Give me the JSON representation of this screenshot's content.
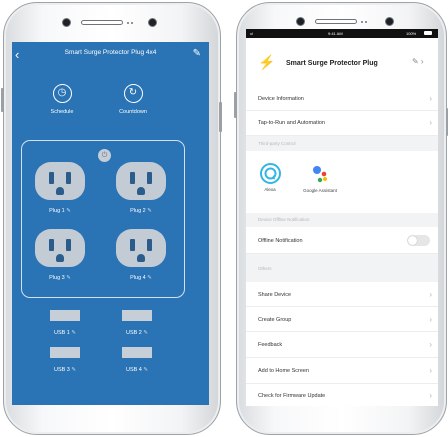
{
  "left": {
    "title": "Smart Surge Protector Plug 4x4",
    "back_icon": "chevron-left-icon",
    "edit_icon": "pencil-icon",
    "tools": [
      {
        "label": "Schedule",
        "icon": "clock-icon"
      },
      {
        "label": "Countdown",
        "icon": "timer-icon"
      }
    ],
    "power_icon": "power-icon",
    "plugs": [
      "Plug 1",
      "Plug 2",
      "Plug 3",
      "Plug 4"
    ],
    "usb": [
      "USB 1",
      "USB 2",
      "USB 3",
      "USB 4"
    ],
    "colors": {
      "background": "#2a73b4",
      "outlet": "#c3ccd5"
    }
  },
  "right": {
    "status": {
      "signal": "ııl",
      "time": "9:41 AM",
      "battery": "100%"
    },
    "device_name": "Smart Surge Protector Plug",
    "rows_top": [
      "Device Information",
      "Tap-to-Run and Automation"
    ],
    "third_party_header": "Third-party Control",
    "third_party": [
      {
        "name": "Alexa",
        "icon": "alexa-icon"
      },
      {
        "name": "Google Assistant",
        "icon": "google-assistant-icon"
      }
    ],
    "offline_header": "Device Offline Notification",
    "offline_row": "Offline Notification",
    "offline_enabled": false,
    "others_header": "Others",
    "rows_bottom": [
      "Share Device",
      "Create Group",
      "Feedback",
      "Add to Home Screen",
      "Check for Firmware Update"
    ]
  }
}
